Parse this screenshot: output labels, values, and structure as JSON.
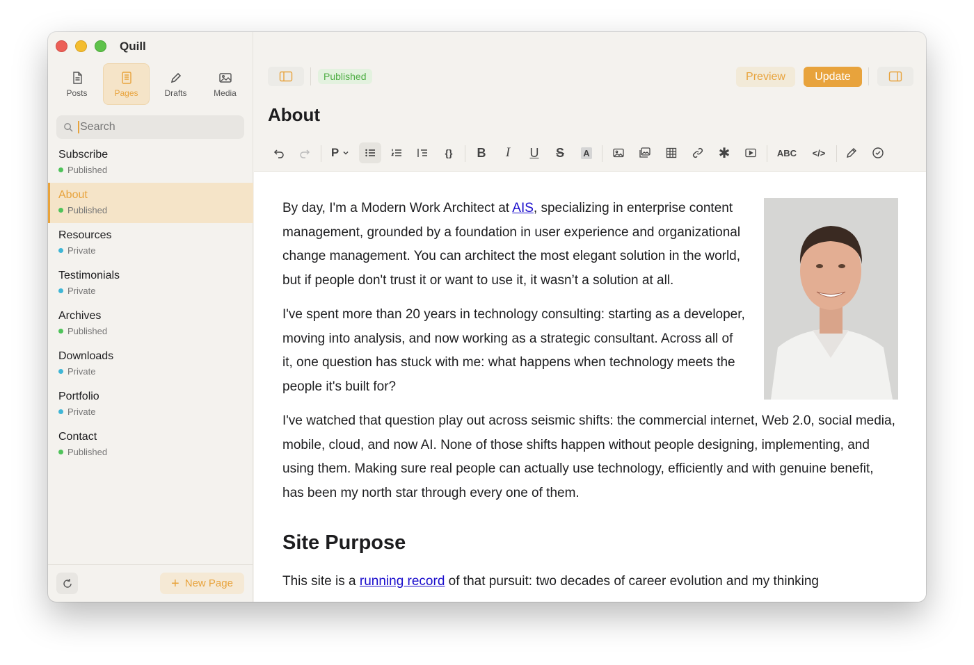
{
  "app": {
    "title": "Quill"
  },
  "sidebar": {
    "tabs": [
      {
        "label": "Posts",
        "icon": "document-icon"
      },
      {
        "label": "Pages",
        "icon": "page-icon",
        "active": true
      },
      {
        "label": "Drafts",
        "icon": "pencil-icon"
      },
      {
        "label": "Media",
        "icon": "image-icon"
      }
    ],
    "search": {
      "placeholder": "Search",
      "value": ""
    },
    "pages": [
      {
        "name": "Subscribe",
        "status": "Published"
      },
      {
        "name": "About",
        "status": "Published",
        "active": true
      },
      {
        "name": "Resources",
        "status": "Private"
      },
      {
        "name": "Testimonials",
        "status": "Private"
      },
      {
        "name": "Archives",
        "status": "Published"
      },
      {
        "name": "Downloads",
        "status": "Private"
      },
      {
        "name": "Portfolio",
        "status": "Private"
      },
      {
        "name": "Contact",
        "status": "Published"
      }
    ],
    "new_page_label": "New Page"
  },
  "header": {
    "status": "Published",
    "preview_label": "Preview",
    "update_label": "Update"
  },
  "document": {
    "title": "About",
    "p1_before_link": "By day, I'm a Modern Work Architect at ",
    "p1_link": "AIS",
    "p1_after_link": ", specializing in enterprise content management, grounded by a foundation in user experience and organizational change management. You can architect the most elegant solution in the world, but if people don't trust it or want to use it, it wasn’t a solution at all.",
    "p2": "I've spent more than 20 years in technology consulting: starting as a developer, moving into analysis, and now working as a strategic consultant. Across all of it, one question has stuck with me: what happens when technology meets the people it's built for?",
    "p3": "I've watched that question play out across seismic shifts: the commercial internet, Web 2.0, social media, mobile, cloud, and now AI. None of those shifts happen without people designing, implementing, and using them. Making sure real people can actually use technology, efficiently and with genuine benefit, has been my north star through every one of them.",
    "heading": "Site Purpose",
    "p4_before_link": "This site is a ",
    "p4_link": "running record",
    "p4_after_link": " of that pursuit: two decades of career evolution and my thinking"
  },
  "toolbar": {
    "paragraph_label": "P",
    "spellcheck_label": "ABC",
    "code_label": "</>",
    "bold_label": "B",
    "italic_label": "I",
    "underline_label": "U",
    "strike_label": "S",
    "highlight_label": "A",
    "codeblock_label": "{}"
  },
  "colors": {
    "accent": "#e8a33c",
    "published": "#4fc35a",
    "private": "#3fb6d6"
  }
}
